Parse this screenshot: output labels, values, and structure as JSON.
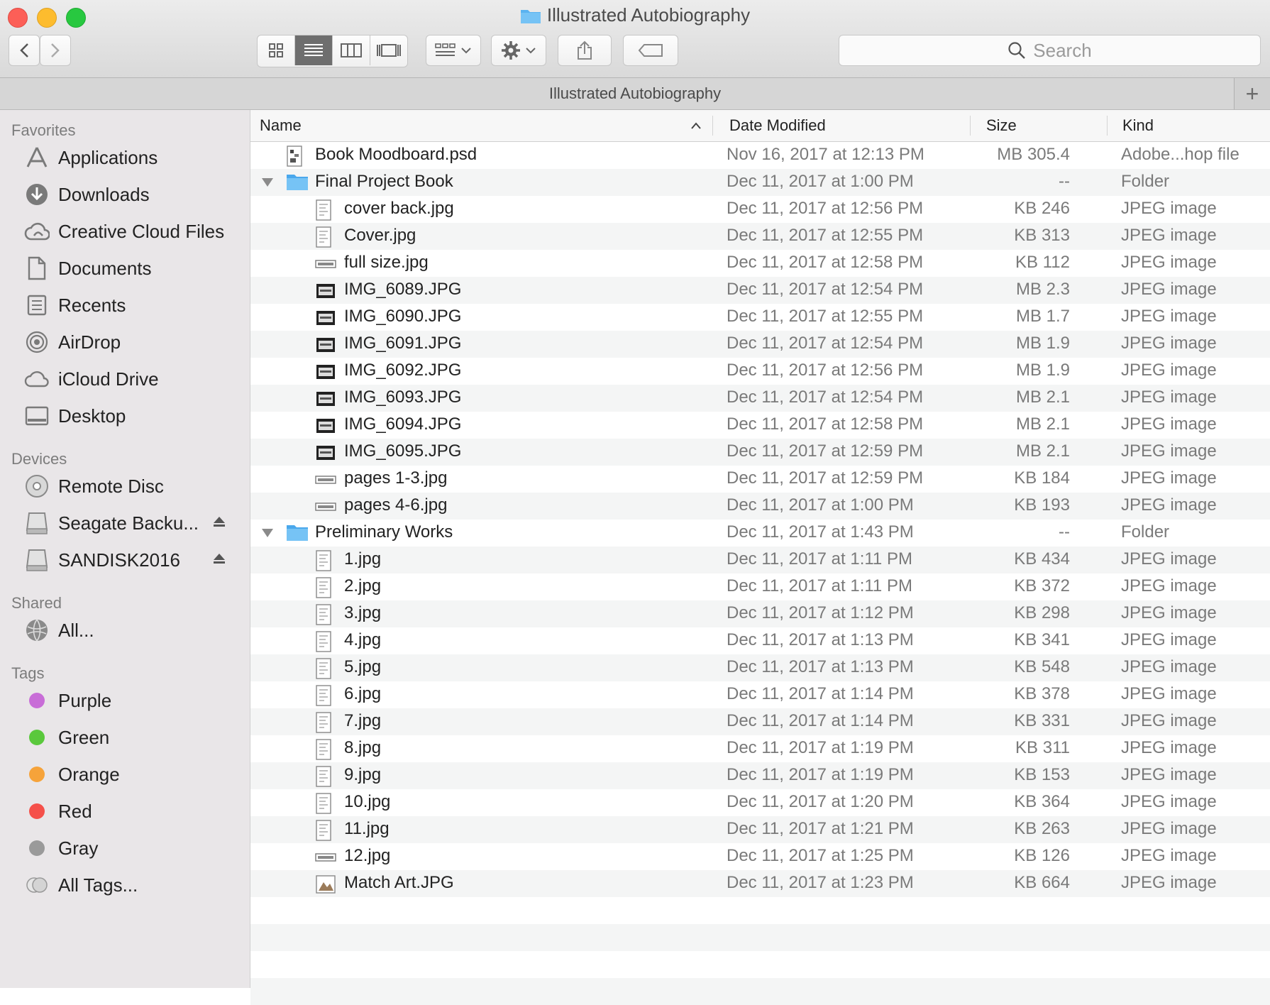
{
  "window": {
    "title": "Illustrated Autobiography"
  },
  "pathbar": {
    "title": "Illustrated Autobiography"
  },
  "search": {
    "placeholder": "Search"
  },
  "sidebar": {
    "sections": [
      {
        "title": "Favorites",
        "items": [
          {
            "label": "Applications",
            "icon": "applications-icon"
          },
          {
            "label": "Downloads",
            "icon": "downloads-icon"
          },
          {
            "label": "Creative Cloud Files",
            "icon": "creative-cloud-icon"
          },
          {
            "label": "Documents",
            "icon": "documents-icon"
          },
          {
            "label": "Recents",
            "icon": "recents-icon"
          },
          {
            "label": "AirDrop",
            "icon": "airdrop-icon"
          },
          {
            "label": "iCloud Drive",
            "icon": "icloud-icon"
          },
          {
            "label": "Desktop",
            "icon": "desktop-icon"
          }
        ]
      },
      {
        "title": "Devices",
        "items": [
          {
            "label": "Remote Disc",
            "icon": "disc-icon"
          },
          {
            "label": "Seagate Backu...",
            "icon": "drive-icon",
            "eject": true
          },
          {
            "label": "SANDISK2016",
            "icon": "drive-icon",
            "eject": true
          }
        ]
      },
      {
        "title": "Shared",
        "items": [
          {
            "label": "All...",
            "icon": "network-icon"
          }
        ]
      },
      {
        "title": "Tags",
        "items": [
          {
            "label": "Purple",
            "color": "#c86dd7"
          },
          {
            "label": "Green",
            "color": "#5ac83c"
          },
          {
            "label": "Orange",
            "color": "#f6a33a"
          },
          {
            "label": "Red",
            "color": "#f5504a"
          },
          {
            "label": "Gray",
            "color": "#9a9a9a"
          },
          {
            "label": "All Tags...",
            "color": "all"
          }
        ]
      }
    ]
  },
  "columns": {
    "name": "Name",
    "date": "Date Modified",
    "size": "Size",
    "kind": "Kind"
  },
  "files": [
    {
      "name": "Book Moodboard.psd",
      "date": "Nov 16, 2017 at 12:13 PM",
      "size": "305.4 MB",
      "kind": "Adobe...hop file",
      "level": 0,
      "type": "psd"
    },
    {
      "name": "Final Project Book",
      "date": "Dec 11, 2017 at 1:00 PM",
      "size": "--",
      "kind": "Folder",
      "level": 0,
      "type": "folder",
      "expanded": true
    },
    {
      "name": "cover back.jpg",
      "date": "Dec 11, 2017 at 12:56 PM",
      "size": "246 KB",
      "kind": "JPEG image",
      "level": 1,
      "type": "jpg"
    },
    {
      "name": "Cover.jpg",
      "date": "Dec 11, 2017 at 12:55 PM",
      "size": "313 KB",
      "kind": "JPEG image",
      "level": 1,
      "type": "jpg"
    },
    {
      "name": "full size.jpg",
      "date": "Dec 11, 2017 at 12:58 PM",
      "size": "112 KB",
      "kind": "JPEG image",
      "level": 1,
      "type": "jpg-wide"
    },
    {
      "name": "IMG_6089.JPG",
      "date": "Dec 11, 2017 at 12:54 PM",
      "size": "2.3 MB",
      "kind": "JPEG image",
      "level": 1,
      "type": "jpg-dark"
    },
    {
      "name": "IMG_6090.JPG",
      "date": "Dec 11, 2017 at 12:55 PM",
      "size": "1.7 MB",
      "kind": "JPEG image",
      "level": 1,
      "type": "jpg-dark"
    },
    {
      "name": "IMG_6091.JPG",
      "date": "Dec 11, 2017 at 12:54 PM",
      "size": "1.9 MB",
      "kind": "JPEG image",
      "level": 1,
      "type": "jpg-dark"
    },
    {
      "name": "IMG_6092.JPG",
      "date": "Dec 11, 2017 at 12:56 PM",
      "size": "1.9 MB",
      "kind": "JPEG image",
      "level": 1,
      "type": "jpg-dark"
    },
    {
      "name": "IMG_6093.JPG",
      "date": "Dec 11, 2017 at 12:54 PM",
      "size": "2.1 MB",
      "kind": "JPEG image",
      "level": 1,
      "type": "jpg-dark"
    },
    {
      "name": "IMG_6094.JPG",
      "date": "Dec 11, 2017 at 12:58 PM",
      "size": "2.1 MB",
      "kind": "JPEG image",
      "level": 1,
      "type": "jpg-dark"
    },
    {
      "name": "IMG_6095.JPG",
      "date": "Dec 11, 2017 at 12:59 PM",
      "size": "2.1 MB",
      "kind": "JPEG image",
      "level": 1,
      "type": "jpg-dark"
    },
    {
      "name": "pages 1-3.jpg",
      "date": "Dec 11, 2017 at 12:59 PM",
      "size": "184 KB",
      "kind": "JPEG image",
      "level": 1,
      "type": "jpg-wide"
    },
    {
      "name": "pages 4-6.jpg",
      "date": "Dec 11, 2017 at 1:00 PM",
      "size": "193 KB",
      "kind": "JPEG image",
      "level": 1,
      "type": "jpg-wide"
    },
    {
      "name": "Preliminary Works",
      "date": "Dec 11, 2017 at 1:43 PM",
      "size": "--",
      "kind": "Folder",
      "level": 0,
      "type": "folder",
      "expanded": true
    },
    {
      "name": "1.jpg",
      "date": "Dec 11, 2017 at 1:11 PM",
      "size": "434 KB",
      "kind": "JPEG image",
      "level": 1,
      "type": "jpg"
    },
    {
      "name": "2.jpg",
      "date": "Dec 11, 2017 at 1:11 PM",
      "size": "372 KB",
      "kind": "JPEG image",
      "level": 1,
      "type": "jpg"
    },
    {
      "name": "3.jpg",
      "date": "Dec 11, 2017 at 1:12 PM",
      "size": "298 KB",
      "kind": "JPEG image",
      "level": 1,
      "type": "jpg"
    },
    {
      "name": "4.jpg",
      "date": "Dec 11, 2017 at 1:13 PM",
      "size": "341 KB",
      "kind": "JPEG image",
      "level": 1,
      "type": "jpg"
    },
    {
      "name": "5.jpg",
      "date": "Dec 11, 2017 at 1:13 PM",
      "size": "548 KB",
      "kind": "JPEG image",
      "level": 1,
      "type": "jpg"
    },
    {
      "name": "6.jpg",
      "date": "Dec 11, 2017 at 1:14 PM",
      "size": "378 KB",
      "kind": "JPEG image",
      "level": 1,
      "type": "jpg"
    },
    {
      "name": "7.jpg",
      "date": "Dec 11, 2017 at 1:14 PM",
      "size": "331 KB",
      "kind": "JPEG image",
      "level": 1,
      "type": "jpg"
    },
    {
      "name": "8.jpg",
      "date": "Dec 11, 2017 at 1:19 PM",
      "size": "311 KB",
      "kind": "JPEG image",
      "level": 1,
      "type": "jpg"
    },
    {
      "name": "9.jpg",
      "date": "Dec 11, 2017 at 1:19 PM",
      "size": "153 KB",
      "kind": "JPEG image",
      "level": 1,
      "type": "jpg"
    },
    {
      "name": "10.jpg",
      "date": "Dec 11, 2017 at 1:20 PM",
      "size": "364 KB",
      "kind": "JPEG image",
      "level": 1,
      "type": "jpg"
    },
    {
      "name": "11.jpg",
      "date": "Dec 11, 2017 at 1:21 PM",
      "size": "263 KB",
      "kind": "JPEG image",
      "level": 1,
      "type": "jpg"
    },
    {
      "name": "12.jpg",
      "date": "Dec 11, 2017 at 1:25 PM",
      "size": "126 KB",
      "kind": "JPEG image",
      "level": 1,
      "type": "jpg-wide"
    },
    {
      "name": "Match Art.JPG",
      "date": "Dec 11, 2017 at 1:23 PM",
      "size": "664 KB",
      "kind": "JPEG image",
      "level": 1,
      "type": "jpg-art"
    }
  ],
  "colors": {
    "folder": "#5ab3f0",
    "selected_view": "#6e6e6e"
  }
}
